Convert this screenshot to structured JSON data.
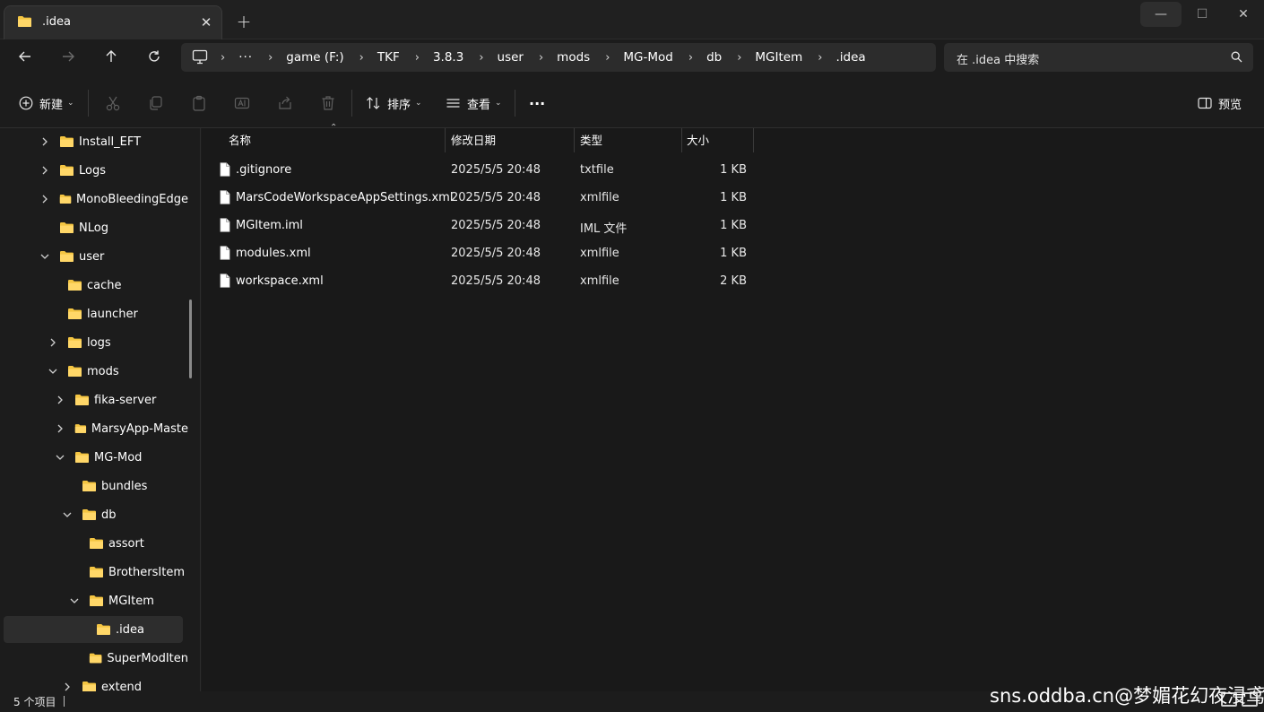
{
  "window": {
    "tab_title": ".idea",
    "tab_close": "✕",
    "new_tab": "+",
    "min": "—",
    "max": "☐",
    "close": "✕"
  },
  "nav": {
    "more": "···",
    "crumbs": [
      "game (F:)",
      "TKF",
      "3.8.3",
      "user",
      "mods",
      "MG-Mod",
      "db",
      "MGItem",
      ".idea"
    ],
    "search_placeholder": "在 .idea 中搜索"
  },
  "toolbar": {
    "new_label": "新建",
    "sort_label": "排序",
    "view_label": "查看",
    "more": "···",
    "preview_label": "预览"
  },
  "sidebar": {
    "items": [
      {
        "label": "Install_EFT",
        "chevron": "right"
      },
      {
        "label": "Logs",
        "chevron": "right"
      },
      {
        "label": "MonoBleedingEdge",
        "chevron": "right"
      },
      {
        "label": "NLog",
        "chevron": "none"
      },
      {
        "label": "user",
        "chevron": "down"
      },
      {
        "label": "cache",
        "chevron": "none"
      },
      {
        "label": "launcher",
        "chevron": "none"
      },
      {
        "label": "logs",
        "chevron": "right"
      },
      {
        "label": "mods",
        "chevron": "down"
      },
      {
        "label": "fika-server",
        "chevron": "right"
      },
      {
        "label": "MarsyApp-Maste",
        "chevron": "right"
      },
      {
        "label": "MG-Mod",
        "chevron": "down"
      },
      {
        "label": "bundles",
        "chevron": "none"
      },
      {
        "label": "db",
        "chevron": "down"
      },
      {
        "label": "assort",
        "chevron": "none"
      },
      {
        "label": "BrothersItem",
        "chevron": "none"
      },
      {
        "label": "MGItem",
        "chevron": "down"
      },
      {
        "label": ".idea",
        "chevron": "none",
        "selected": true
      },
      {
        "label": "SuperModIten",
        "chevron": "none"
      },
      {
        "label": "extend",
        "chevron": "right"
      }
    ]
  },
  "columns": {
    "name": "名称",
    "date": "修改日期",
    "type": "类型",
    "size": "大小"
  },
  "files": [
    {
      "name": ".gitignore",
      "date": "2025/5/5 20:48",
      "type": "txtfile",
      "size": "1 KB"
    },
    {
      "name": "MarsCodeWorkspaceAppSettings.xml",
      "date": "2025/5/5 20:48",
      "type": "xmlfile",
      "size": "1 KB"
    },
    {
      "name": "MGItem.iml",
      "date": "2025/5/5 20:48",
      "type": "IML 文件",
      "size": "1 KB"
    },
    {
      "name": "modules.xml",
      "date": "2025/5/5 20:48",
      "type": "xmlfile",
      "size": "1 KB"
    },
    {
      "name": "workspace.xml",
      "date": "2025/5/5 20:48",
      "type": "xmlfile",
      "size": "2 KB"
    }
  ],
  "status": {
    "count": "5 个项目"
  },
  "watermark": "sns.oddba.cn@梦媚花幻夜浸鸢",
  "colors": {
    "folder": "#f4c542",
    "background": "#191919",
    "selected": "#2d2d2d"
  }
}
